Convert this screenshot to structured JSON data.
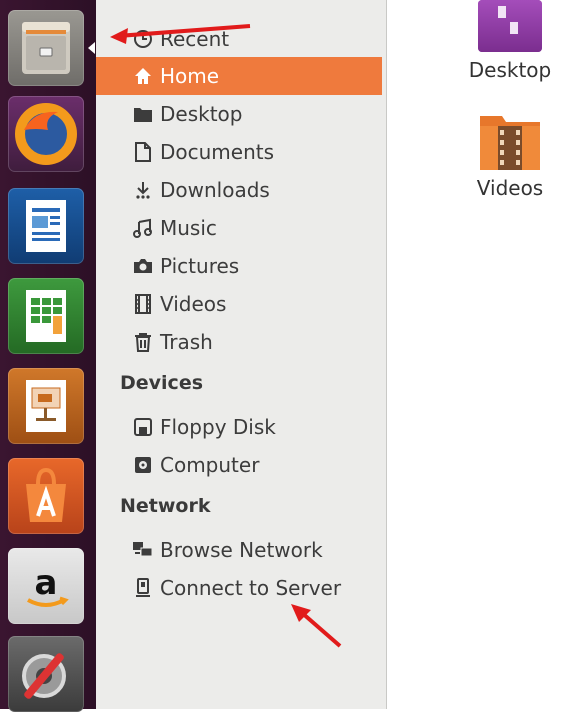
{
  "launcher": {
    "items": [
      {
        "name": "Files"
      },
      {
        "name": "Firefox Web Browser"
      },
      {
        "name": "LibreOffice Writer"
      },
      {
        "name": "LibreOffice Calc"
      },
      {
        "name": "LibreOffice Impress"
      },
      {
        "name": "Ubuntu Software Center"
      },
      {
        "name": "Amazon"
      },
      {
        "name": "System Settings"
      }
    ]
  },
  "sidebar": {
    "places": [
      {
        "label": "Recent",
        "icon": "clock-icon"
      },
      {
        "label": "Home",
        "icon": "home-icon",
        "selected": true
      },
      {
        "label": "Desktop",
        "icon": "folder-icon"
      },
      {
        "label": "Documents",
        "icon": "document-icon"
      },
      {
        "label": "Downloads",
        "icon": "download-icon"
      },
      {
        "label": "Music",
        "icon": "music-icon"
      },
      {
        "label": "Pictures",
        "icon": "camera-icon"
      },
      {
        "label": "Videos",
        "icon": "film-icon"
      },
      {
        "label": "Trash",
        "icon": "trash-icon"
      }
    ],
    "devices_header": "Devices",
    "devices": [
      {
        "label": "Floppy Disk",
        "icon": "floppy-icon"
      },
      {
        "label": "Computer",
        "icon": "computer-icon"
      }
    ],
    "network_header": "Network",
    "network": [
      {
        "label": "Browse Network",
        "icon": "network-icon"
      },
      {
        "label": "Connect to Server",
        "icon": "server-icon"
      }
    ]
  },
  "main": {
    "items": [
      {
        "label": "Desktop",
        "icon": "desktop-folder-icon"
      },
      {
        "label": "Videos",
        "icon": "videos-folder-icon"
      }
    ]
  },
  "colors": {
    "selected": "#ef7a3d",
    "launcher": "#2c1026",
    "annotation_arrow": "#e11b1b"
  }
}
